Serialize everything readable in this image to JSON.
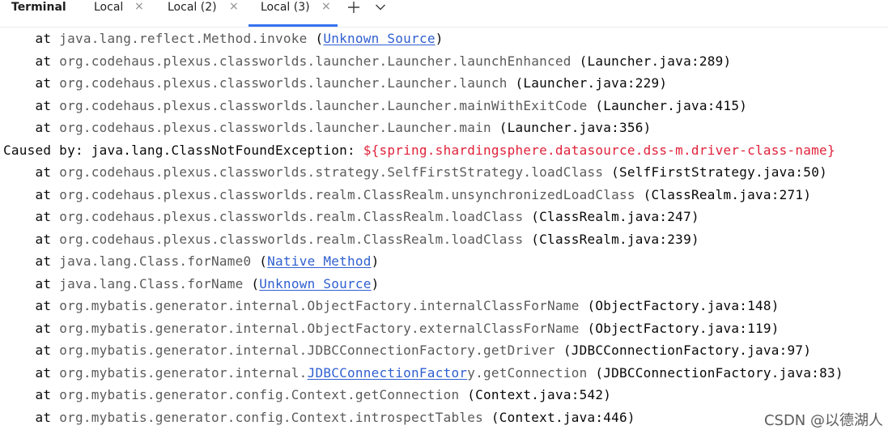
{
  "header": {
    "title": "Terminal",
    "tabs": [
      {
        "label": "Local",
        "active": false
      },
      {
        "label": "Local (2)",
        "active": false
      },
      {
        "label": "Local (3)",
        "active": true
      }
    ],
    "close_glyph": "×",
    "new_tab_icon": "plus-icon",
    "dropdown_icon": "chevron-down-icon",
    "accent_color": "#3574f0"
  },
  "console": {
    "indent": "    ",
    "at": "at",
    "caused_prefix": "Caused by: java.lang.ClassNotFoundException: ",
    "caused_message": "${spring.shardingsphere.datasource.dss-m.driver-class-name}",
    "open_paren": "(",
    "close_paren": ")",
    "lines": [
      {
        "frame": "java.lang.reflect.Method.invoke",
        "loc": "Unknown Source",
        "link": true
      },
      {
        "frame": "org.codehaus.plexus.classworlds.launcher.Launcher.launchEnhanced",
        "loc": "Launcher.java:289"
      },
      {
        "frame": "org.codehaus.plexus.classworlds.launcher.Launcher.launch",
        "loc": "Launcher.java:229"
      },
      {
        "frame": "org.codehaus.plexus.classworlds.launcher.Launcher.mainWithExitCode",
        "loc": "Launcher.java:415"
      },
      {
        "frame": "org.codehaus.plexus.classworlds.launcher.Launcher.main",
        "loc": "Launcher.java:356"
      },
      {
        "caused": true
      },
      {
        "frame": "org.codehaus.plexus.classworlds.strategy.SelfFirstStrategy.loadClass",
        "loc": "SelfFirstStrategy.java:50"
      },
      {
        "frame": "org.codehaus.plexus.classworlds.realm.ClassRealm.unsynchronizedLoadClass",
        "loc": "ClassRealm.java:271"
      },
      {
        "frame": "org.codehaus.plexus.classworlds.realm.ClassRealm.loadClass",
        "loc": "ClassRealm.java:247"
      },
      {
        "frame": "org.codehaus.plexus.classworlds.realm.ClassRealm.loadClass",
        "loc": "ClassRealm.java:239"
      },
      {
        "frame": "java.lang.Class.forName0",
        "loc": "Native Method",
        "link": true
      },
      {
        "frame": "java.lang.Class.forName",
        "loc": "Unknown Source",
        "link": true
      },
      {
        "frame": "org.mybatis.generator.internal.ObjectFactory.internalClassForName",
        "loc": "ObjectFactory.java:148"
      },
      {
        "frame": "org.mybatis.generator.internal.ObjectFactory.externalClassForName",
        "loc": "ObjectFactory.java:119"
      },
      {
        "frame": "org.mybatis.generator.internal.JDBCConnectionFactory.getDriver",
        "loc": "JDBCConnectionFactory.java:97"
      },
      {
        "frame_pre": "org.mybatis.generator.internal.",
        "frame_link": "JDBCConnectionFactor",
        "frame_post": "y.getConnection",
        "loc": "JDBCConnectionFactory.java:83"
      },
      {
        "frame": "org.mybatis.generator.config.Context.getConnection",
        "loc": "Context.java:542"
      },
      {
        "frame": "org.mybatis.generator.config.Context.introspectTables",
        "loc": "Context.java:446"
      }
    ]
  },
  "watermark": "CSDN @以德湖人",
  "colors": {
    "error": "#e0223a",
    "link": "#2f5fd0",
    "frame": "#5a5a5a"
  }
}
